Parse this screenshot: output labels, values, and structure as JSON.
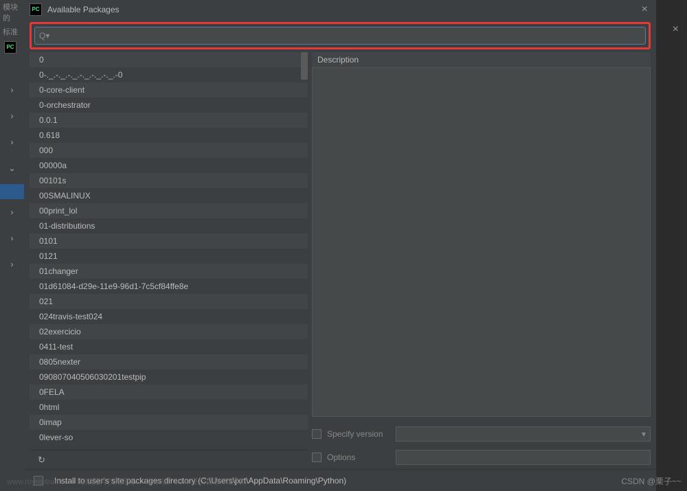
{
  "icons": {
    "pc": "PC"
  },
  "dialog": {
    "title": "Available Packages",
    "search_value": "",
    "description_header": "Description",
    "specify_version_label": "Specify version",
    "options_label": "Options",
    "install_user_site": "Install to user's site packages directory (C:\\Users\\jxrt\\AppData\\Roaming\\Python)"
  },
  "packages": [
    "0",
    "0-._.-._.-._.-._.-._.-._.-0",
    "0-core-client",
    "0-orchestrator",
    "0.0.1",
    "0.618",
    "000",
    "00000a",
    "00101s",
    "00SMALINUX",
    "00print_lol",
    "01-distributions",
    "0101",
    "0121",
    "01changer",
    "01d61084-d29e-11e9-96d1-7c5cf84ffe8e",
    "021",
    "024travis-test024",
    "02exercicio",
    "0411-test",
    "0805nexter",
    "090807040506030201testpip",
    "0FELA",
    "0html",
    "0imap",
    "0lever-so"
  ],
  "watermark": "CSDN @栗子~~",
  "notice": "www.roymoban.com 网站图片仅用展示，非存储。如有侵权请联系删除。"
}
